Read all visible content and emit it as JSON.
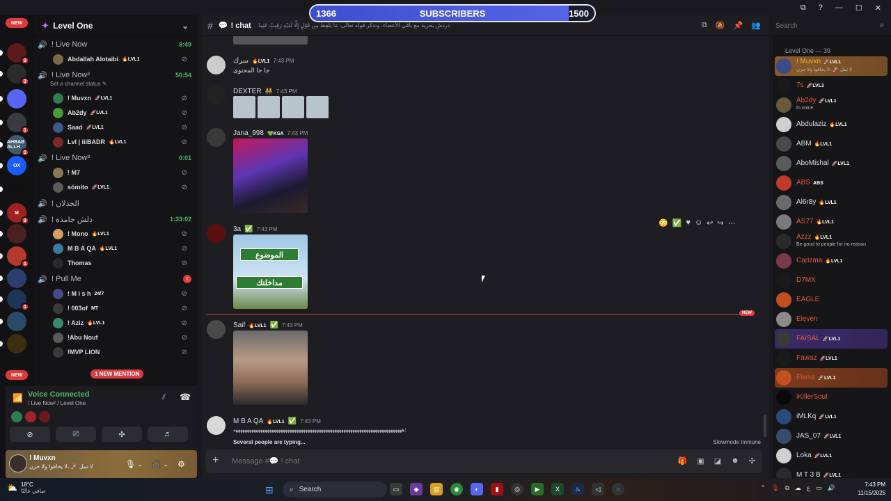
{
  "overlay": {
    "current": "1366",
    "label": "SUBSCRIBERS",
    "goal": "1500",
    "progress_fraction": 0.91
  },
  "servers": [
    {
      "label": "NEW",
      "type": "tag"
    },
    {
      "badge": "2",
      "color": "#5b1a1a"
    },
    {
      "badge": "3",
      "color": "#2b2b2b"
    },
    {
      "badge": "",
      "color": "#5865f2"
    },
    {
      "badge": "1",
      "color": "#3a3a44"
    },
    {
      "badge": "1",
      "color": "#3d5a6e",
      "text": "AHBAB ALLH"
    },
    {
      "badge": "",
      "color": "#1a5cff",
      "text": "OX"
    },
    {
      "badge": "",
      "color": "#111"
    },
    {
      "badge": "2",
      "color": "#a02020",
      "text": "M"
    },
    {
      "badge": "",
      "color": "#4a2020"
    },
    {
      "badge": "1",
      "color": "#b43a2a"
    },
    {
      "badge": "",
      "color": "#2c3e6e"
    },
    {
      "badge": "1",
      "color": "#1d3558"
    },
    {
      "badge": "",
      "color": "#2a4a6a"
    },
    {
      "badge": "",
      "color": "#3a3010"
    },
    {
      "label": "NEW",
      "type": "tag"
    }
  ],
  "server_name": "Level One",
  "voice_channels": [
    {
      "name": "! Live Now",
      "timer": "8:49",
      "users": [
        {
          "name": "Abdallah Alotaibi",
          "tag": "🔥LVL1"
        }
      ]
    },
    {
      "name": "! Live Now²",
      "timer": "50:54",
      "status": "Set a channel status ✎",
      "users": [
        {
          "name": "! Muvxn",
          "tag": "🚀LVL1"
        },
        {
          "name": "Ab2dy",
          "tag": "🚀LVL1"
        },
        {
          "name": "Saad",
          "tag": "🚀LVL1"
        },
        {
          "name": "Lvl | iiiBADR",
          "tag": "🔥LVL1"
        }
      ]
    },
    {
      "name": "! Live Now³",
      "timer": "0:01",
      "users": [
        {
          "name": "! M7",
          "tag": ""
        },
        {
          "name": "sómito",
          "tag": "🚀LVL1"
        }
      ]
    },
    {
      "name": "! الخذلان",
      "timer": ""
    },
    {
      "name": "! دلش جامدة",
      "timer": "1:33:02",
      "users": [
        {
          "name": "! Mono",
          "tag": "🔥LVL1"
        },
        {
          "name": "M B A QA",
          "tag": "🔥LVL1"
        },
        {
          "name": "Thomas",
          "tag": ""
        }
      ]
    },
    {
      "name": "! Pull Me",
      "timer": "",
      "users": [
        {
          "name": "! M i s h",
          "tag": "24/7"
        },
        {
          "name": "! 003of",
          "tag": "MT"
        },
        {
          "name": "! Aziz",
          "tag": "🔥LVL1"
        },
        {
          "name": "!Abu Nouf",
          "tag": ""
        },
        {
          "name": "!MVP LION",
          "tag": ""
        }
      ]
    }
  ],
  "pull_me_badge": "1",
  "mention_pill": "1 NEW MENTION",
  "voice_panel": {
    "title": "Voice Connected",
    "subtitle": "! Live Now² / Level One"
  },
  "user_panel": {
    "name": "! Muvxn",
    "status": "لا تمل 🚀 ،لا يخافوا ولا حزن"
  },
  "chat": {
    "channel": "! chat",
    "topic": "دردش بحرية مع باقي الأعضاء، وتذكر قوله تعالى: مَا يَلْفِظُ مِن قَوْلٍ إِلَّا لَدَيْهِ رَقِيبٌ عَتِيدٌ",
    "messages": [
      {
        "author": "سرك",
        "tag": "🔥LVL1",
        "time": "7:43 PM",
        "text": "جا جا المحتوى"
      },
      {
        "author": "DEXTER",
        "tag": "",
        "time": "7:43 PM",
        "text": ""
      },
      {
        "author": "Jana_998",
        "tag": "💚KSA",
        "time": "7:43 PM",
        "text": ""
      },
      {
        "author": "3a",
        "tag": "",
        "time": "7:43 PM",
        "text": ""
      },
      {
        "author": "Saif",
        "tag": "🔥LVL1",
        "time": "7:43 PM",
        "text": ""
      },
      {
        "author": "M B A QA",
        "tag": "🔥LVL1",
        "time": "7:43 PM",
        "text": "؛هههههههههههههههههههههههههههههههههههههههههههههههههههههههههههههههههههههههههههه"
      }
    ],
    "sign_text": {
      "top": "الموضوع",
      "bottom": "مداخلتك"
    },
    "new_label": "NEW",
    "typing": "Several people are typing...",
    "slowmode": "Slowmode Immune",
    "composer_placeholder": "Message #💬 ! chat"
  },
  "members": {
    "search_placeholder": "Search",
    "header": "Level One — 39",
    "list": [
      {
        "name": "! Muvxn",
        "tag": "🚀LVL1",
        "sub": "لا تمل 🚀 ،لا يخافوا ولا حزن",
        "color": "#f0b232",
        "highlight": "#8a5a2a"
      },
      {
        "name": "7s",
        "tag": "🚀LVL1",
        "sub": "",
        "color": "#e5593a"
      },
      {
        "name": "Ab2dy",
        "tag": "🚀LVL1",
        "sub": "In voice",
        "color": "#e5593a"
      },
      {
        "name": "Abdulaziz",
        "tag": "🔥LVL1",
        "sub": "",
        "color": "#dbdee1"
      },
      {
        "name": "ABM",
        "tag": "🔥LVL1",
        "sub": "",
        "color": "#dbdee1"
      },
      {
        "name": "AboMishal",
        "tag": "🚀LVL1",
        "sub": "",
        "color": "#dbdee1"
      },
      {
        "name": "ABS",
        "tag": "ABS",
        "sub": "",
        "color": "#e5593a"
      },
      {
        "name": "Al6r8y",
        "tag": "🔥LVL1",
        "sub": "",
        "color": "#dbdee1"
      },
      {
        "name": "AS77",
        "tag": "🔥LVL1",
        "sub": "",
        "color": "#e5593a"
      },
      {
        "name": "Azzz",
        "tag": "🔥LVL1",
        "sub": "Be good to people for no reason",
        "color": "#e5593a"
      },
      {
        "name": "Carizma",
        "tag": "🔥LVL1",
        "sub": "",
        "color": "#e5593a"
      },
      {
        "name": "D7MX",
        "tag": "",
        "sub": "",
        "color": "#e5593a"
      },
      {
        "name": "EAGLE",
        "tag": "",
        "sub": "",
        "color": "#e5593a"
      },
      {
        "name": "Eleven",
        "tag": "",
        "sub": "",
        "color": "#e5593a"
      },
      {
        "name": "FAISAL",
        "tag": "🚀LVL1",
        "sub": "",
        "color": "#e5593a",
        "highlight": "#3a2a6a"
      },
      {
        "name": "Fawaz",
        "tag": "🚀LVL1",
        "sub": "",
        "color": "#e5593a"
      },
      {
        "name": "Flamz",
        "tag": "🚀LVL1",
        "sub": "",
        "color": "#e5593a",
        "highlight": "#7a3a1a"
      },
      {
        "name": "iKillerSoul",
        "tag": "",
        "sub": "",
        "color": "#e5593a"
      },
      {
        "name": "iMLKq",
        "tag": "🚀LVL1",
        "sub": "",
        "color": "#dbdee1"
      },
      {
        "name": "JAS_07",
        "tag": "🚀LVL1",
        "sub": "",
        "color": "#dbdee1"
      },
      {
        "name": "Loka",
        "tag": "🚀LVL1",
        "sub": "",
        "color": "#dbdee1"
      },
      {
        "name": "M T 3 B",
        "tag": "🚀LVL1",
        "sub": "",
        "color": "#dbdee1"
      }
    ]
  },
  "taskbar": {
    "temp": "18°C",
    "condition": "صافي غالبًا",
    "search": "Search",
    "lang": "ع",
    "time": "7:43 PM",
    "date": "11/15/2025"
  }
}
